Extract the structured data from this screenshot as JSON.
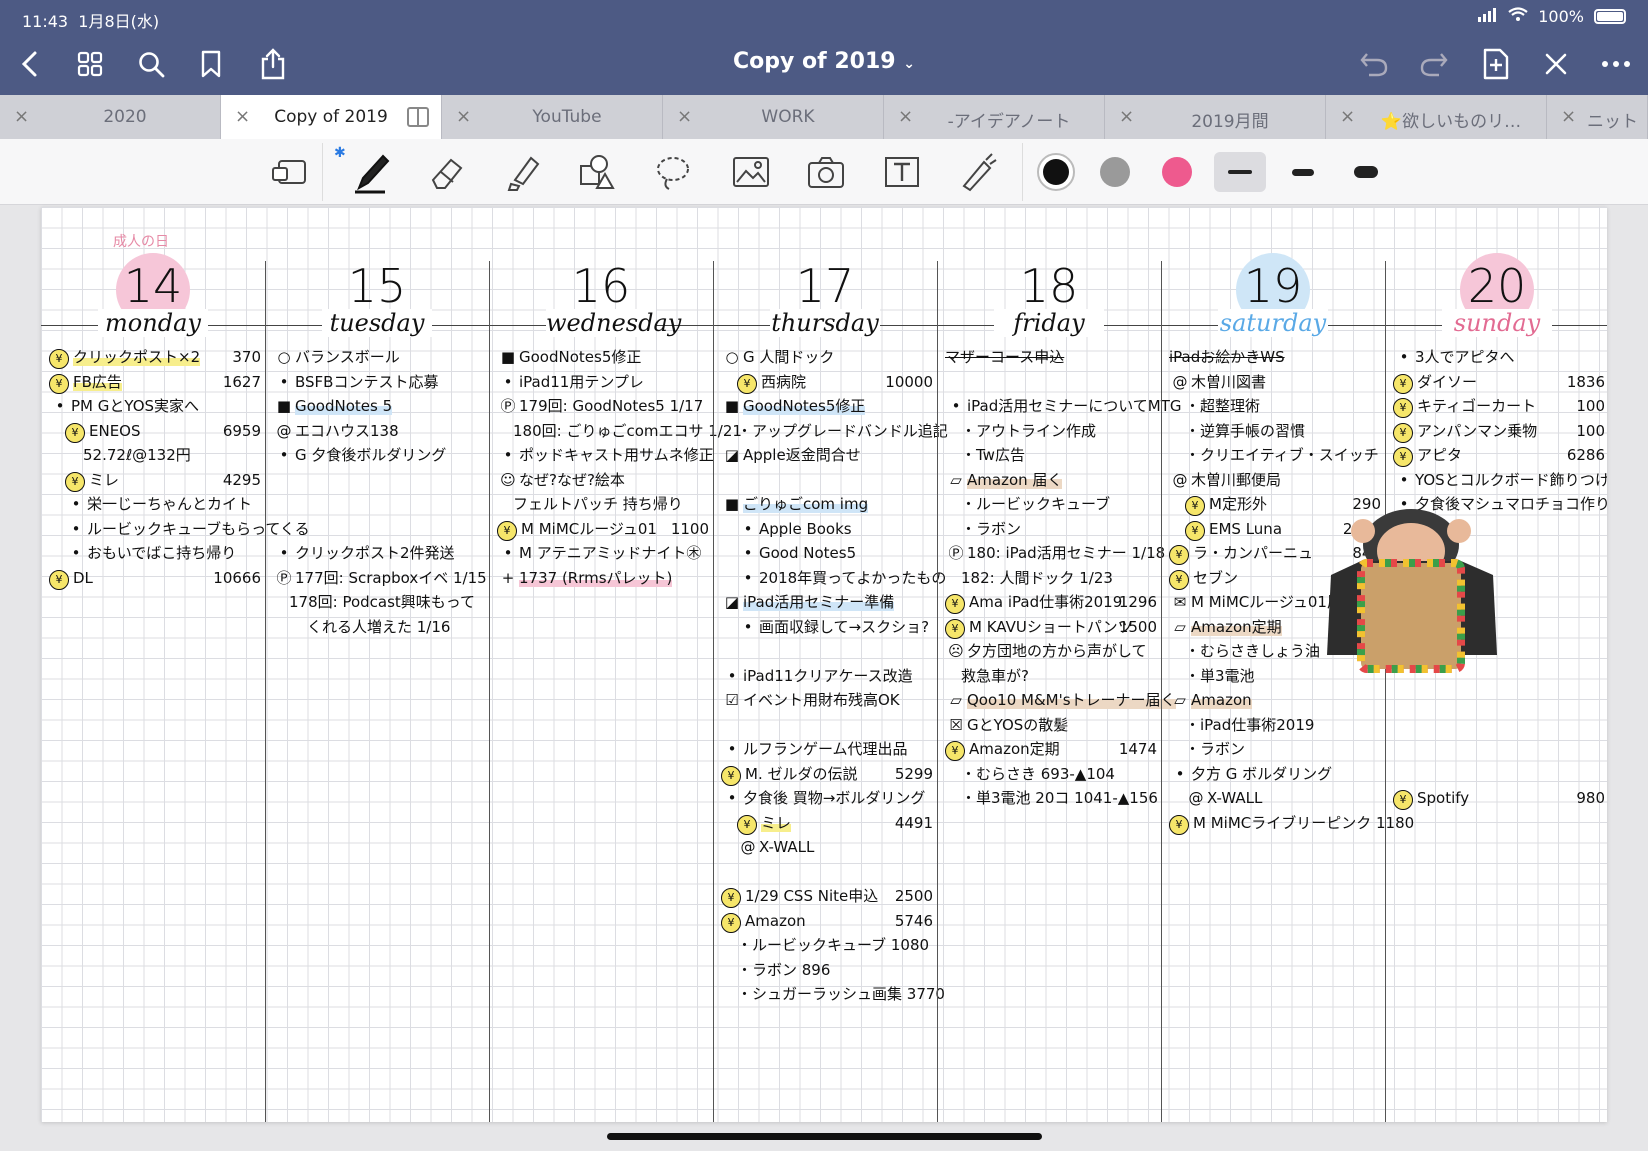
{
  "status": {
    "time": "11:43",
    "date": "1月8日(水)",
    "battery": "100%"
  },
  "header": {
    "title": "Copy of 2019"
  },
  "tabs": [
    {
      "label": "2020",
      "active": false
    },
    {
      "label": "Copy of 2019",
      "active": true
    },
    {
      "label": "YouTube",
      "active": false
    },
    {
      "label": "WORK",
      "active": false
    },
    {
      "label": "-アイデアノート",
      "active": false
    },
    {
      "label": "2019月間",
      "active": false
    },
    {
      "label": "⭐欲しいものリ…",
      "active": false
    },
    {
      "label": "ニット",
      "active": false
    }
  ],
  "colors": {
    "black": "#111111",
    "gray": "#9a9a9a",
    "pink": "#ee5a8e",
    "accent": "#4d5a84"
  },
  "days": [
    {
      "num": "14",
      "name": "monday",
      "holiday": "成人の日",
      "circle": "#f6c6d8",
      "entries": [
        {
          "b": "¥",
          "t": "クリックポスト×2",
          "a": "370",
          "hl": "yellow"
        },
        {
          "b": "¥",
          "t": "FB広告",
          "a": "1627",
          "hl": "yellow"
        },
        {
          "b": "•",
          "t": "PM GとYOS実家へ"
        },
        {
          "b": "¥",
          "t": "ENEOS",
          "a": "6959",
          "ind": 1
        },
        {
          "b": "",
          "t": "52.72ℓ@132円",
          "ind": 2
        },
        {
          "b": "¥",
          "t": "ミレ",
          "a": "4295",
          "ind": 1
        },
        {
          "b": "•",
          "t": "栄一じーちゃんとカイト",
          "ind": 1
        },
        {
          "b": "•",
          "t": "ルービックキューブもらってくる",
          "ind": 1
        },
        {
          "b": "•",
          "t": "おもいでばこ持ち帰り",
          "ind": 1
        },
        {
          "b": "¥",
          "t": "DL",
          "a": "10666"
        }
      ]
    },
    {
      "num": "15",
      "name": "tuesday",
      "holiday": "",
      "circle": "",
      "entries": [
        {
          "b": "○",
          "t": "バランスボール"
        },
        {
          "b": "•",
          "t": "BSFBコンテスト応募"
        },
        {
          "b": "■",
          "t": "GoodNotes 5",
          "hl": "blue"
        },
        {
          "b": "@",
          "t": "エコハウス138"
        },
        {
          "b": "•",
          "t": "G 夕食後ボルダリング"
        },
        {
          "b": "",
          "t": ""
        },
        {
          "b": "",
          "t": ""
        },
        {
          "b": "",
          "t": ""
        },
        {
          "b": "•",
          "t": "クリックポスト2件発送"
        },
        {
          "b": "Ⓟ",
          "t": "177回: Scrapboxイベ 1/15"
        },
        {
          "b": "",
          "t": "178回: Podcast興味もって",
          "ind": 1
        },
        {
          "b": "",
          "t": "くれる人増えた 1/16",
          "ind": 2
        }
      ]
    },
    {
      "num": "16",
      "name": "wednesday",
      "holiday": "",
      "circle": "",
      "entries": [
        {
          "b": "■",
          "t": "GoodNotes5修正"
        },
        {
          "b": "•",
          "t": "iPad11用テンプレ"
        },
        {
          "b": "Ⓟ",
          "t": "179回: GoodNotes5 1/17"
        },
        {
          "b": "",
          "t": "180回: ごりゅごcomエコサ 1/21",
          "ind": 1
        },
        {
          "b": "•",
          "t": "ポッドキャスト用サムネ修正"
        },
        {
          "b": "☺",
          "t": "なぜ?なぜ?絵本"
        },
        {
          "b": "",
          "t": "フェルトパッチ 持ち帰り",
          "ind": 1
        },
        {
          "b": "¥",
          "t": "M MiMCルージュ01",
          "a": "1100"
        },
        {
          "b": "•",
          "t": "M アテニアミッドナイト㊍"
        },
        {
          "b": "+",
          "t": "1737 (Rrmsパレット)",
          "hl": "pink"
        }
      ]
    },
    {
      "num": "17",
      "name": "thursday",
      "holiday": "",
      "circle": "",
      "entries": [
        {
          "b": "○",
          "t": "G 人間ドック"
        },
        {
          "b": "¥",
          "t": "西病院",
          "a": "10000",
          "ind": 1
        },
        {
          "b": "■",
          "t": "GoodNotes5修正",
          "hl": "blue"
        },
        {
          "b": "",
          "t": "・アップグレードバンドル追記",
          "ind": 1
        },
        {
          "b": "◪",
          "t": "Apple返金問合せ"
        },
        {
          "b": "",
          "t": ""
        },
        {
          "b": "■",
          "t": "ごりゅごcom img",
          "hl": "blue"
        },
        {
          "b": "•",
          "t": "Apple Books",
          "ind": 1
        },
        {
          "b": "•",
          "t": "Good Notes5",
          "ind": 1
        },
        {
          "b": "•",
          "t": "2018年買ってよかったもの",
          "ind": 1
        },
        {
          "b": "◪",
          "t": "iPad活用セミナー準備",
          "hl": "blue"
        },
        {
          "b": "•",
          "t": "画面収録して→スクショ?",
          "ind": 1
        },
        {
          "b": "",
          "t": ""
        },
        {
          "b": "•",
          "t": "iPad11クリアケース改造"
        },
        {
          "b": "☑",
          "t": "イベント用財布残高OK"
        },
        {
          "b": "",
          "t": ""
        },
        {
          "b": "•",
          "t": "ルフランゲーム代理出品"
        },
        {
          "b": "¥",
          "t": "M. ゼルダの伝説",
          "a": "5299"
        },
        {
          "b": "•",
          "t": "夕食後 買物→ボルダリング"
        },
        {
          "b": "¥",
          "t": "ミレ",
          "a": "4491",
          "ind": 1,
          "hl": "yellow"
        },
        {
          "b": "@",
          "t": "X-WALL",
          "ind": 1
        },
        {
          "b": "",
          "t": ""
        },
        {
          "b": "¥",
          "t": "1/29 CSS Nite申込",
          "a": "2500"
        },
        {
          "b": "¥",
          "t": "Amazon",
          "a": "5746"
        },
        {
          "b": "",
          "t": "・ルービックキューブ 1080",
          "ind": 1
        },
        {
          "b": "",
          "t": "・ラボン 896",
          "ind": 1
        },
        {
          "b": "",
          "t": "・シュガーラッシュ画集 3770",
          "ind": 1
        }
      ]
    },
    {
      "num": "18",
      "name": "friday",
      "holiday": "",
      "circle": "",
      "entries": [
        {
          "b": "",
          "t": "マザーコース申込",
          "strike": true
        },
        {
          "b": "",
          "t": ""
        },
        {
          "b": "•",
          "t": "iPad活用セミナーについてMTG"
        },
        {
          "b": "",
          "t": "・アウトライン作成",
          "ind": 1
        },
        {
          "b": "",
          "t": "・Tw広告",
          "ind": 1
        },
        {
          "b": "▱",
          "t": "Amazon 届く",
          "hl": "tan"
        },
        {
          "b": "",
          "t": "・ルービックキューブ",
          "ind": 1
        },
        {
          "b": "",
          "t": "・ラボン",
          "ind": 1
        },
        {
          "b": "Ⓟ",
          "t": "180: iPad活用セミナー 1/18"
        },
        {
          "b": "",
          "t": "182: 人間ドック 1/23",
          "ind": 1
        },
        {
          "b": "¥",
          "t": "Ama iPad仕事術2019",
          "a": "1296"
        },
        {
          "b": "¥",
          "t": "M KAVUショートパンツ",
          "a": "1500"
        },
        {
          "b": "☹",
          "t": "夕方団地の方から声がして"
        },
        {
          "b": "",
          "t": "救急車が?",
          "ind": 1
        },
        {
          "b": "▱",
          "t": "Qoo10 M&M'sトレーナー届く",
          "hl": "tan"
        },
        {
          "b": "☒",
          "t": "GとYOSの散髪"
        },
        {
          "b": "¥",
          "t": "Amazon定期",
          "a": "1474"
        },
        {
          "b": "",
          "t": "・むらさき 693-▲104",
          "ind": 1
        },
        {
          "b": "",
          "t": "・単3電池 20コ 1041-▲156",
          "ind": 1
        }
      ]
    },
    {
      "num": "19",
      "name": "saturday",
      "holiday": "",
      "circle": "#cfe6f7",
      "entries": [
        {
          "b": "",
          "t": "iPadお絵かきWS",
          "strike": true
        },
        {
          "b": "@",
          "t": "木曽川図書"
        },
        {
          "b": "",
          "t": "・超整理術",
          "ind": 1
        },
        {
          "b": "",
          "t": "・逆算手帳の習慣",
          "ind": 1
        },
        {
          "b": "",
          "t": "・クリエイティブ・スイッチ",
          "ind": 1
        },
        {
          "b": "@",
          "t": "木曽川郵便局"
        },
        {
          "b": "¥",
          "t": "M定形外",
          "a": "290",
          "ind": 1
        },
        {
          "b": "¥",
          "t": "EMS Luna",
          "a": "2000",
          "ind": 1
        },
        {
          "b": "¥",
          "t": "ラ・カンパーニュ",
          "a": "840"
        },
        {
          "b": "¥",
          "t": "セブン",
          "a": "790"
        },
        {
          "b": "✉",
          "t": "M MiMCルージュ01届く"
        },
        {
          "b": "▱",
          "t": "Amazon定期",
          "hl": "tan"
        },
        {
          "b": "",
          "t": "・むらさきしょう油",
          "ind": 1
        },
        {
          "b": "",
          "t": "・単3電池",
          "ind": 1
        },
        {
          "b": "▱",
          "t": "Amazon",
          "hl": "tan"
        },
        {
          "b": "",
          "t": "・iPad仕事術2019",
          "ind": 1
        },
        {
          "b": "",
          "t": "・ラボン",
          "ind": 1
        },
        {
          "b": "•",
          "t": "夕方 G ボルダリング"
        },
        {
          "b": "@",
          "t": "X-WALL",
          "ind": 1
        },
        {
          "b": "¥",
          "t": "M MiMCライブリーピンク 1180"
        }
      ]
    },
    {
      "num": "20",
      "name": "sunday",
      "holiday": "",
      "circle": "#f6c6d8",
      "entries": [
        {
          "b": "•",
          "t": "3人でアピタへ"
        },
        {
          "b": "¥",
          "t": "ダイソー",
          "a": "1836"
        },
        {
          "b": "¥",
          "t": "キティゴーカート",
          "a": "100"
        },
        {
          "b": "¥",
          "t": "アンパンマン乗物",
          "a": "100"
        },
        {
          "b": "¥",
          "t": "アピタ",
          "a": "6286"
        },
        {
          "b": "•",
          "t": "YOSとコルクボード飾りつけ"
        },
        {
          "b": "•",
          "t": "夕食後マシュマロチョコ作り"
        },
        {
          "b": "",
          "t": ""
        },
        {
          "b": "",
          "t": ""
        },
        {
          "b": "",
          "t": ""
        },
        {
          "b": "",
          "t": ""
        },
        {
          "b": "",
          "t": ""
        },
        {
          "b": "",
          "t": ""
        },
        {
          "b": "",
          "t": ""
        },
        {
          "b": "",
          "t": ""
        },
        {
          "b": "",
          "t": ""
        },
        {
          "b": "",
          "t": ""
        },
        {
          "b": "",
          "t": ""
        },
        {
          "b": "¥",
          "t": "Spotify",
          "a": "980"
        }
      ]
    }
  ]
}
